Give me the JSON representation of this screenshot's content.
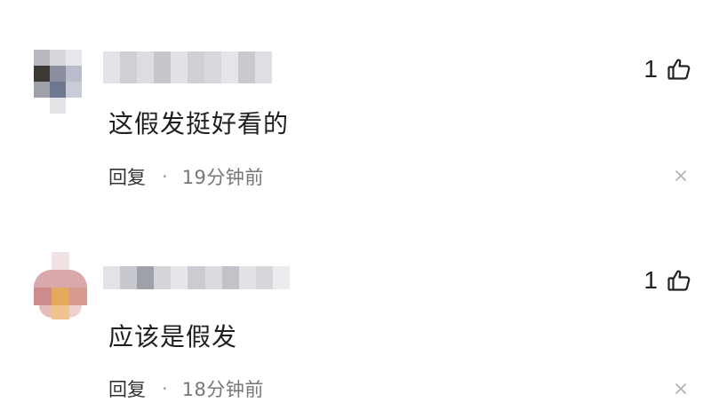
{
  "comments": [
    {
      "text": "这假发挺好看的",
      "reply_label": "回复",
      "separator": "·",
      "time": "19分钟前",
      "like_count": "1",
      "icons": {
        "like": "thumbs-up-icon",
        "dismiss": "close-icon"
      }
    },
    {
      "text": "应该是假发",
      "reply_label": "回复",
      "separator": "·",
      "time": "18分钟前",
      "like_count": "1",
      "icons": {
        "like": "thumbs-up-icon",
        "dismiss": "close-icon"
      }
    }
  ],
  "colors": {
    "background": "#ffffff",
    "text": "#1f1f1f",
    "meta": "#777777"
  }
}
